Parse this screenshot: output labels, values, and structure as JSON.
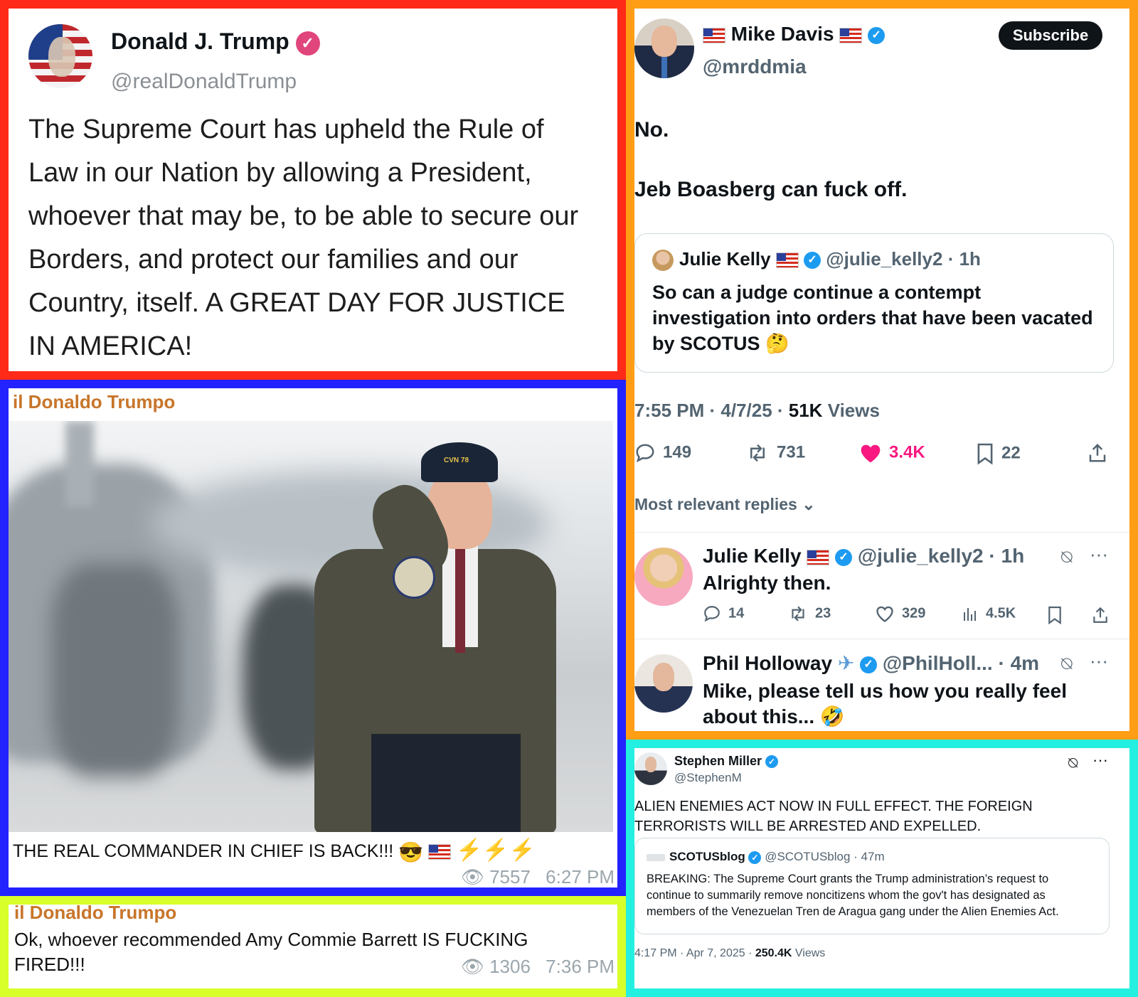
{
  "truth": {
    "name": "Donald J. Trump",
    "handle": "@realDonaldTrump",
    "text": "The Supreme Court has upheld the Rule of Law in our Nation by allowing a President, whoever that may be, to be able to secure our Borders, and protect our families and our Country, itself. A GREAT DAY FOR JUSTICE IN AMERICA!"
  },
  "telegram1": {
    "channel": "il Donaldo Trumpo",
    "caption": "THE REAL COMMANDER IN CHIEF IS BACK!!!",
    "views": "7557",
    "time": "6:27 PM",
    "photo_cap_text": "CVN 78"
  },
  "telegram2": {
    "channel": "il Donaldo Trumpo",
    "text": "Ok, whoever recommended Amy Commie Barrett IS FUCKING FIRED!!!",
    "views": "1306",
    "time": "7:36 PM"
  },
  "davis": {
    "name": "Mike Davis",
    "handle": "@mrddmia",
    "subscribe_label": "Subscribe",
    "line1": "No.",
    "line2": "Jeb Boasberg can fuck off.",
    "quote": {
      "name": "Julie Kelly",
      "handle": "@julie_kelly2",
      "age": "· 1h",
      "text": "So can a judge continue a contempt investigation into orders that have been vacated by SCOTUS"
    },
    "time": "7:55 PM · 4/7/25 · ",
    "views_count": "51K",
    "views_label": " Views",
    "replies": "149",
    "reposts": "731",
    "likes": "3.4K",
    "bookmarks": "22",
    "sort_label": "Most relevant replies",
    "reply1": {
      "name": "Julie Kelly",
      "handle": "@julie_kelly2",
      "age": "· 1h",
      "text": "Alrighty then.",
      "replies": "14",
      "reposts": "23",
      "likes": "329",
      "views": "4.5K"
    },
    "reply2": {
      "name": "Phil Holloway",
      "handle": "@PhilHoll...",
      "age": "· 4m",
      "text": "Mike, please tell us how you really feel about this..."
    }
  },
  "miller": {
    "name": "Stephen Miller",
    "handle": "@StephenM",
    "text": "ALIEN ENEMIES ACT NOW IN FULL EFFECT. THE FOREIGN TERRORISTS WILL BE ARRESTED AND EXPELLED.",
    "quote": {
      "name": "SCOTUSblog",
      "handle": "@SCOTUSblog",
      "age": "· 47m",
      "text": "BREAKING: The Supreme Court grants the Trump administration’s request to continue to summarily remove noncitizens whom the gov't has designated as members of the Venezuelan Tren de Aragua gang under the Alien Enemies Act."
    },
    "time": "4:17 PM · Apr 7, 2025 · ",
    "views_count": "250.4K",
    "views_label": " Views"
  }
}
